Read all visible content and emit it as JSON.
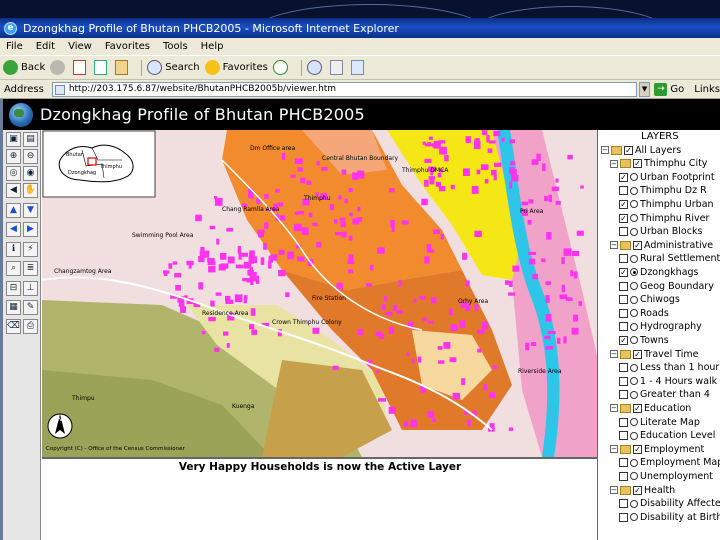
{
  "window": {
    "title": "Dzongkhag Profile of Bhutan PHCB2005 - Microsoft Internet Explorer"
  },
  "menu": [
    "File",
    "Edit",
    "View",
    "Favorites",
    "Tools",
    "Help"
  ],
  "toolbar": {
    "back": "Back",
    "search": "Search",
    "favorites": "Favorites"
  },
  "address": {
    "label": "Address",
    "url": "http://203.175.6.87/website/BhutanPHCB2005b/viewer.htm",
    "go": "Go",
    "links": "Links"
  },
  "app": {
    "title": "Dzongkhag Profile of Bhutan PHCB2005"
  },
  "map": {
    "labels": {
      "dm": "Dm Office area",
      "central": "Central Bhutan Boundary",
      "thimphu": "Thimphu DMCA",
      "pool": "Swimming Pool Area",
      "changzam": "Changzamtog Area",
      "chang": "Chang Ramlla Area",
      "thim": "Thimphu",
      "pri": "Pri Area",
      "fire": "Fire Station",
      "residence": "Residence Area",
      "crown": "Crown Thimphu Colony",
      "orhy": "Orhy Area",
      "thimpu2": "Thimpu",
      "kuenga": "Kuenga",
      "riverside": "Riverside Area",
      "copyright": "Copyright (C) - Office of the Census Commissioner"
    },
    "overview": {
      "bhutan": "Bhutan",
      "thimphu": "Thimphu",
      "dzong": "Dzongkhag"
    }
  },
  "status": {
    "text": "Very Happy Households is now the Active Layer"
  },
  "layers": {
    "title": "LAYERS",
    "items": [
      {
        "label": "All Layers",
        "level": 0,
        "type": "group"
      },
      {
        "label": "Thimphu City",
        "level": 1,
        "type": "group"
      },
      {
        "label": "Urban Footprint",
        "level": 2,
        "type": "layer",
        "checked": true
      },
      {
        "label": "Thimphu Dz R",
        "level": 2,
        "type": "layer",
        "checked": false
      },
      {
        "label": "Thimphu Urban",
        "level": 2,
        "type": "layer",
        "checked": true
      },
      {
        "label": "Thimphu River",
        "level": 2,
        "type": "layer",
        "checked": true
      },
      {
        "label": "Urban Blocks",
        "level": 2,
        "type": "layer",
        "checked": false
      },
      {
        "label": "Administrative",
        "level": 1,
        "type": "group"
      },
      {
        "label": "Rural Settlement",
        "level": 2,
        "type": "layer",
        "checked": false
      },
      {
        "label": "Dzongkhags",
        "level": 2,
        "type": "layer",
        "checked": true
      },
      {
        "label": "Geog Boundary",
        "level": 2,
        "type": "layer",
        "checked": false
      },
      {
        "label": "Chiwogs",
        "level": 2,
        "type": "layer",
        "checked": false
      },
      {
        "label": "Roads",
        "level": 2,
        "type": "layer",
        "checked": false
      },
      {
        "label": "Hydrography",
        "level": 2,
        "type": "layer",
        "checked": false
      },
      {
        "label": "Towns",
        "level": 2,
        "type": "layer",
        "checked": true
      },
      {
        "label": "Travel Time",
        "level": 1,
        "type": "group"
      },
      {
        "label": "Less than 1 hour",
        "level": 2,
        "type": "layer",
        "checked": false
      },
      {
        "label": "1 - 4 Hours walk",
        "level": 2,
        "type": "layer",
        "checked": false
      },
      {
        "label": "Greater than 4",
        "level": 2,
        "type": "layer",
        "checked": false
      },
      {
        "label": "Education",
        "level": 1,
        "type": "group"
      },
      {
        "label": "Literate Map",
        "level": 2,
        "type": "layer",
        "checked": false
      },
      {
        "label": "Education Level",
        "level": 2,
        "type": "layer",
        "checked": false
      },
      {
        "label": "Employment",
        "level": 1,
        "type": "group"
      },
      {
        "label": "Employment Map",
        "level": 2,
        "type": "layer",
        "checked": false
      },
      {
        "label": "Unemployment",
        "level": 2,
        "type": "layer",
        "checked": false
      },
      {
        "label": "Health",
        "level": 1,
        "type": "group"
      },
      {
        "label": "Disability Affected",
        "level": 2,
        "type": "layer",
        "checked": false
      },
      {
        "label": "Disability at Birth",
        "level": 2,
        "type": "layer",
        "checked": false
      }
    ]
  },
  "colors": {
    "pink": "#ff33ee",
    "orange": "#f28a2e",
    "yellow": "#f5e616",
    "river": "#2ec6e8"
  }
}
